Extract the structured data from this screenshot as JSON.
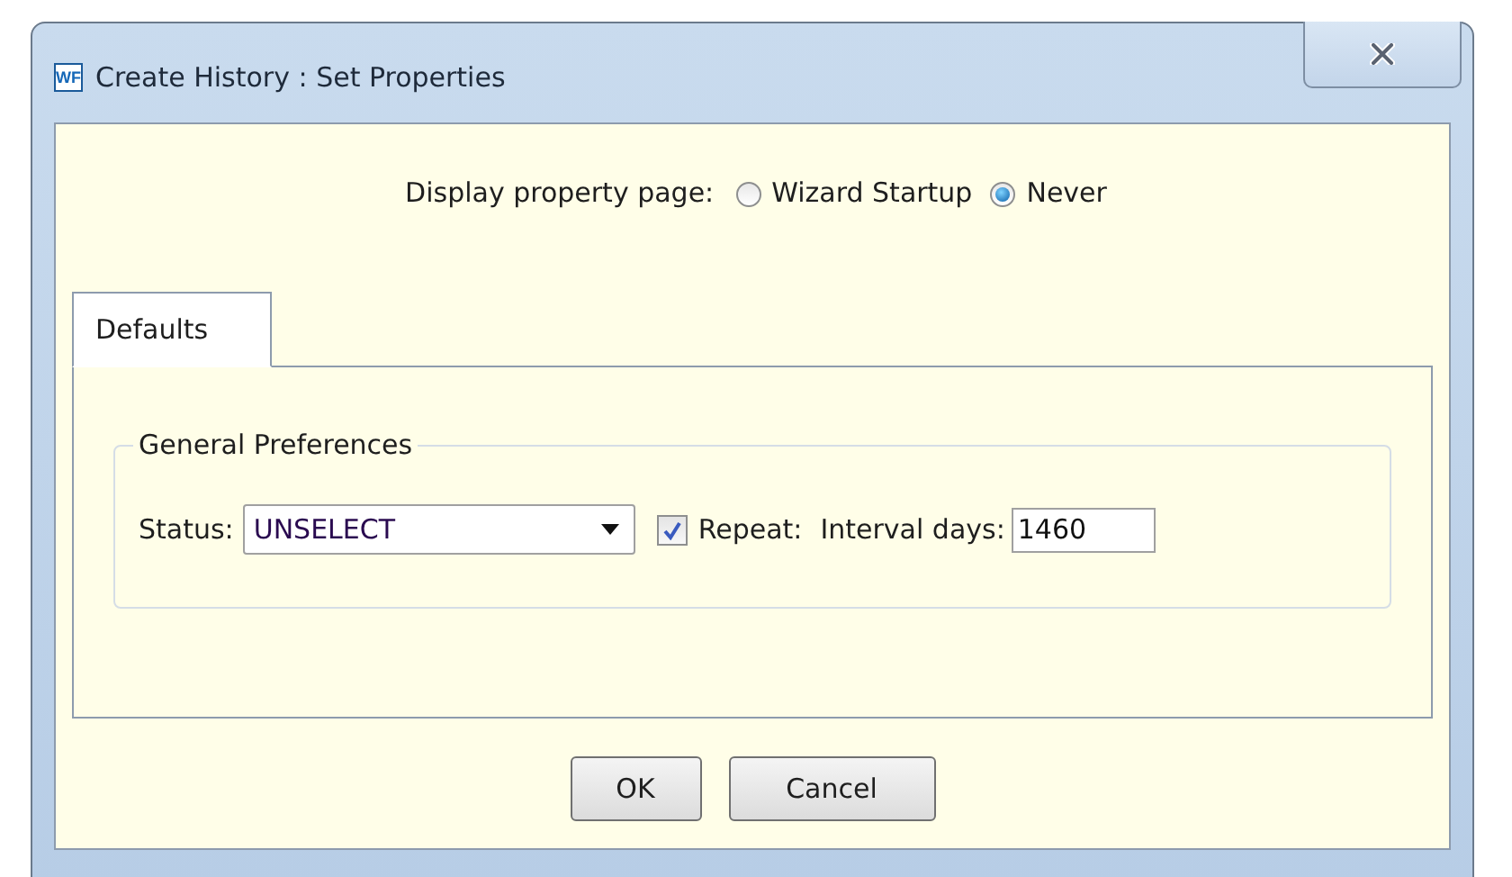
{
  "window": {
    "icon_text": "WF",
    "title": "Create History : Set Properties"
  },
  "display_property_page": {
    "label": "Display property page:",
    "options": [
      {
        "label": "Wizard Startup",
        "selected": false
      },
      {
        "label": "Never",
        "selected": true
      }
    ]
  },
  "tabs": [
    {
      "label": "Defaults",
      "selected": true
    }
  ],
  "group": {
    "title": "General Preferences",
    "status": {
      "label": "Status:",
      "value": "UNSELECT"
    },
    "repeat": {
      "label": "Repeat:",
      "checked": true
    },
    "interval": {
      "label": "Interval days:",
      "value": "1460"
    }
  },
  "buttons": [
    "OK",
    "Cancel"
  ]
}
